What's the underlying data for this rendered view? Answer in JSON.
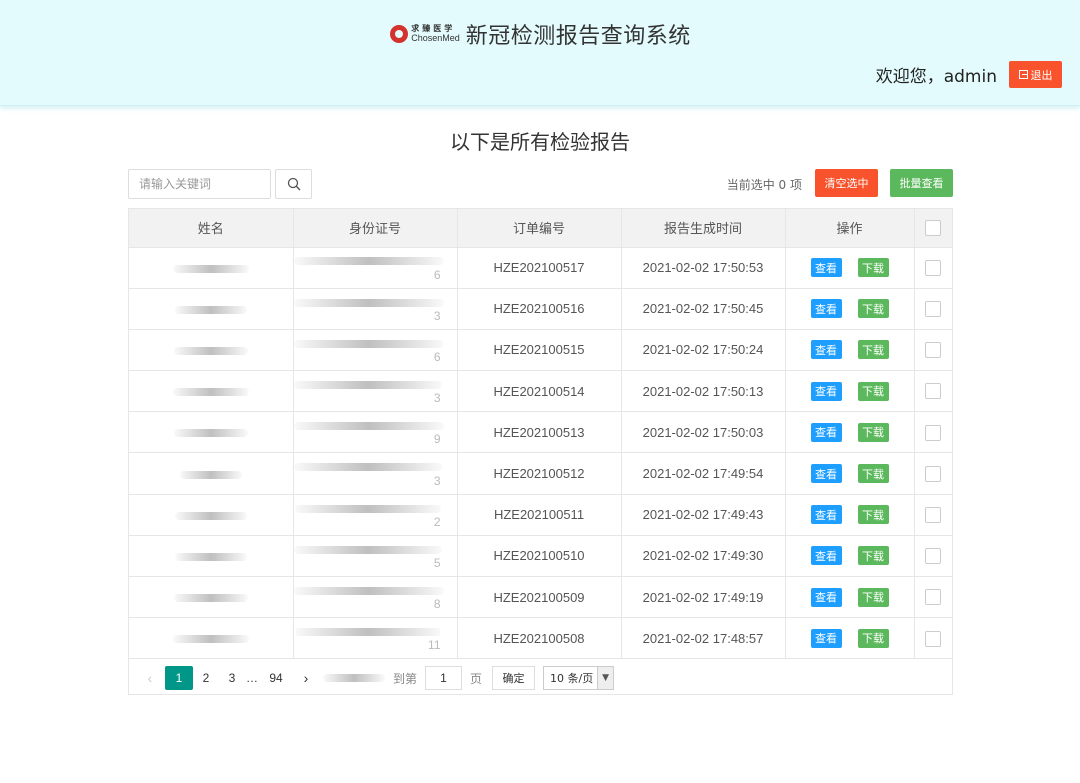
{
  "header": {
    "logo_cn": "求臻医学",
    "logo_en": "ChosenMed",
    "app_title": "新冠检测报告查询系统",
    "welcome": "欢迎您，admin",
    "logout_label": "退出"
  },
  "main": {
    "heading": "以下是所有检验报告",
    "search_placeholder": "请输入关键词",
    "selected_count": "当前选中 0 项",
    "clear_label": "清空选中",
    "batch_label": "批量查看"
  },
  "table": {
    "columns": [
      "姓名",
      "身份证号",
      "订单编号",
      "报告生成时间",
      "操作"
    ],
    "view_label": "查看",
    "download_label": "下载",
    "rows": [
      {
        "id_tail": "6",
        "order": "HZE202100517",
        "time": "2021-02-02 17:50:53"
      },
      {
        "id_tail": "3",
        "order": "HZE202100516",
        "time": "2021-02-02 17:50:45"
      },
      {
        "id_tail": "6",
        "order": "HZE202100515",
        "time": "2021-02-02 17:50:24"
      },
      {
        "id_tail": "3",
        "order": "HZE202100514",
        "time": "2021-02-02 17:50:13"
      },
      {
        "id_tail": "9",
        "order": "HZE202100513",
        "time": "2021-02-02 17:50:03"
      },
      {
        "id_tail": "3",
        "order": "HZE202100512",
        "time": "2021-02-02 17:49:54"
      },
      {
        "id_tail": "2",
        "order": "HZE202100511",
        "time": "2021-02-02 17:49:43"
      },
      {
        "id_tail": "5",
        "order": "HZE202100510",
        "time": "2021-02-02 17:49:30"
      },
      {
        "id_tail": "8",
        "order": "HZE202100509",
        "time": "2021-02-02 17:49:19"
      },
      {
        "id_tail": "11",
        "order": "HZE202100508",
        "time": "2021-02-02 17:48:57"
      }
    ]
  },
  "pagination": {
    "pages": [
      "1",
      "2",
      "3",
      "…",
      "94"
    ],
    "goto_label": "到第",
    "goto_value": "1",
    "page_unit": "页",
    "confirm_label": "确定",
    "page_size": "10 条/页"
  },
  "colors": {
    "header_bg": "#e3fbfc",
    "danger": "#f8532c",
    "success": "#5cb85c",
    "primary": "#1e9fff",
    "pager_active": "#009688"
  }
}
